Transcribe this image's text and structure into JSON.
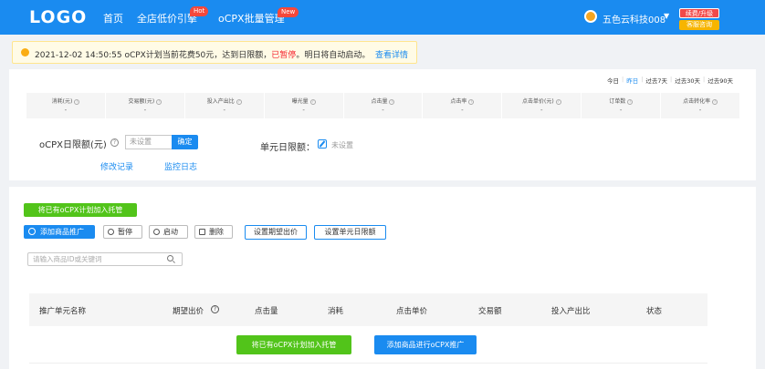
{
  "header": {
    "logo": "LOGO",
    "nav": [
      {
        "label": "首页"
      },
      {
        "label": "全店低价引擎",
        "badge": "Hot"
      },
      {
        "label": "oCPX批量管理",
        "badge": "New"
      }
    ],
    "account": "五色云科技008",
    "renew_label": "续费/升级",
    "support_label": "客服咨询"
  },
  "notice": {
    "text_before": "2021-12-02 14:50:55 oCPX计划当前花费50元，达到日限额，",
    "warn": "已暂停",
    "text_after": "。明日将自动启动。",
    "link": "查看详情"
  },
  "ranges": [
    "今日",
    "昨日",
    "过去7天",
    "过去30天",
    "过去90天"
  ],
  "active_range": "昨日",
  "stats": [
    {
      "label": "消耗(元)",
      "value": "-"
    },
    {
      "label": "交易额(元)",
      "value": "-"
    },
    {
      "label": "投入产出比",
      "value": "-"
    },
    {
      "label": "曝光量",
      "value": "-"
    },
    {
      "label": "点击量",
      "value": "-"
    },
    {
      "label": "点击率",
      "value": "-"
    },
    {
      "label": "点击单价(元)",
      "value": "-"
    },
    {
      "label": "订单数",
      "value": "-"
    },
    {
      "label": "点击转化率",
      "value": "-"
    }
  ],
  "budget": {
    "label": "oCPX日限额(元)",
    "placeholder": "未设置",
    "confirm": "确定",
    "link_history": "修改记录",
    "link_monitor": "监控日志",
    "unit_label": "单元日限额：",
    "unit_value": "未设置"
  },
  "toolbar": {
    "add_existing": "将已有oCPX计划加入托管",
    "add_product": "添加商品推广",
    "pause": "暂停",
    "start": "启动",
    "delete": "删除",
    "set_bid": "设置期望出价",
    "set_unit_budget": "设置单元日限额",
    "search_placeholder": "请输入商品ID或关键词"
  },
  "table": {
    "columns": [
      "推广单元名称",
      "期望出价",
      "点击量",
      "消耗",
      "点击单价",
      "交易额",
      "投入产出比",
      "状态"
    ]
  },
  "empty": {
    "add_existing": "将已有oCPX计划加入托管",
    "add_product": "添加商品进行oCPX推广"
  },
  "colors": {
    "primary": "#1a8bf0",
    "success": "#52c41a",
    "danger": "#f5222d",
    "warning": "#faad14"
  }
}
